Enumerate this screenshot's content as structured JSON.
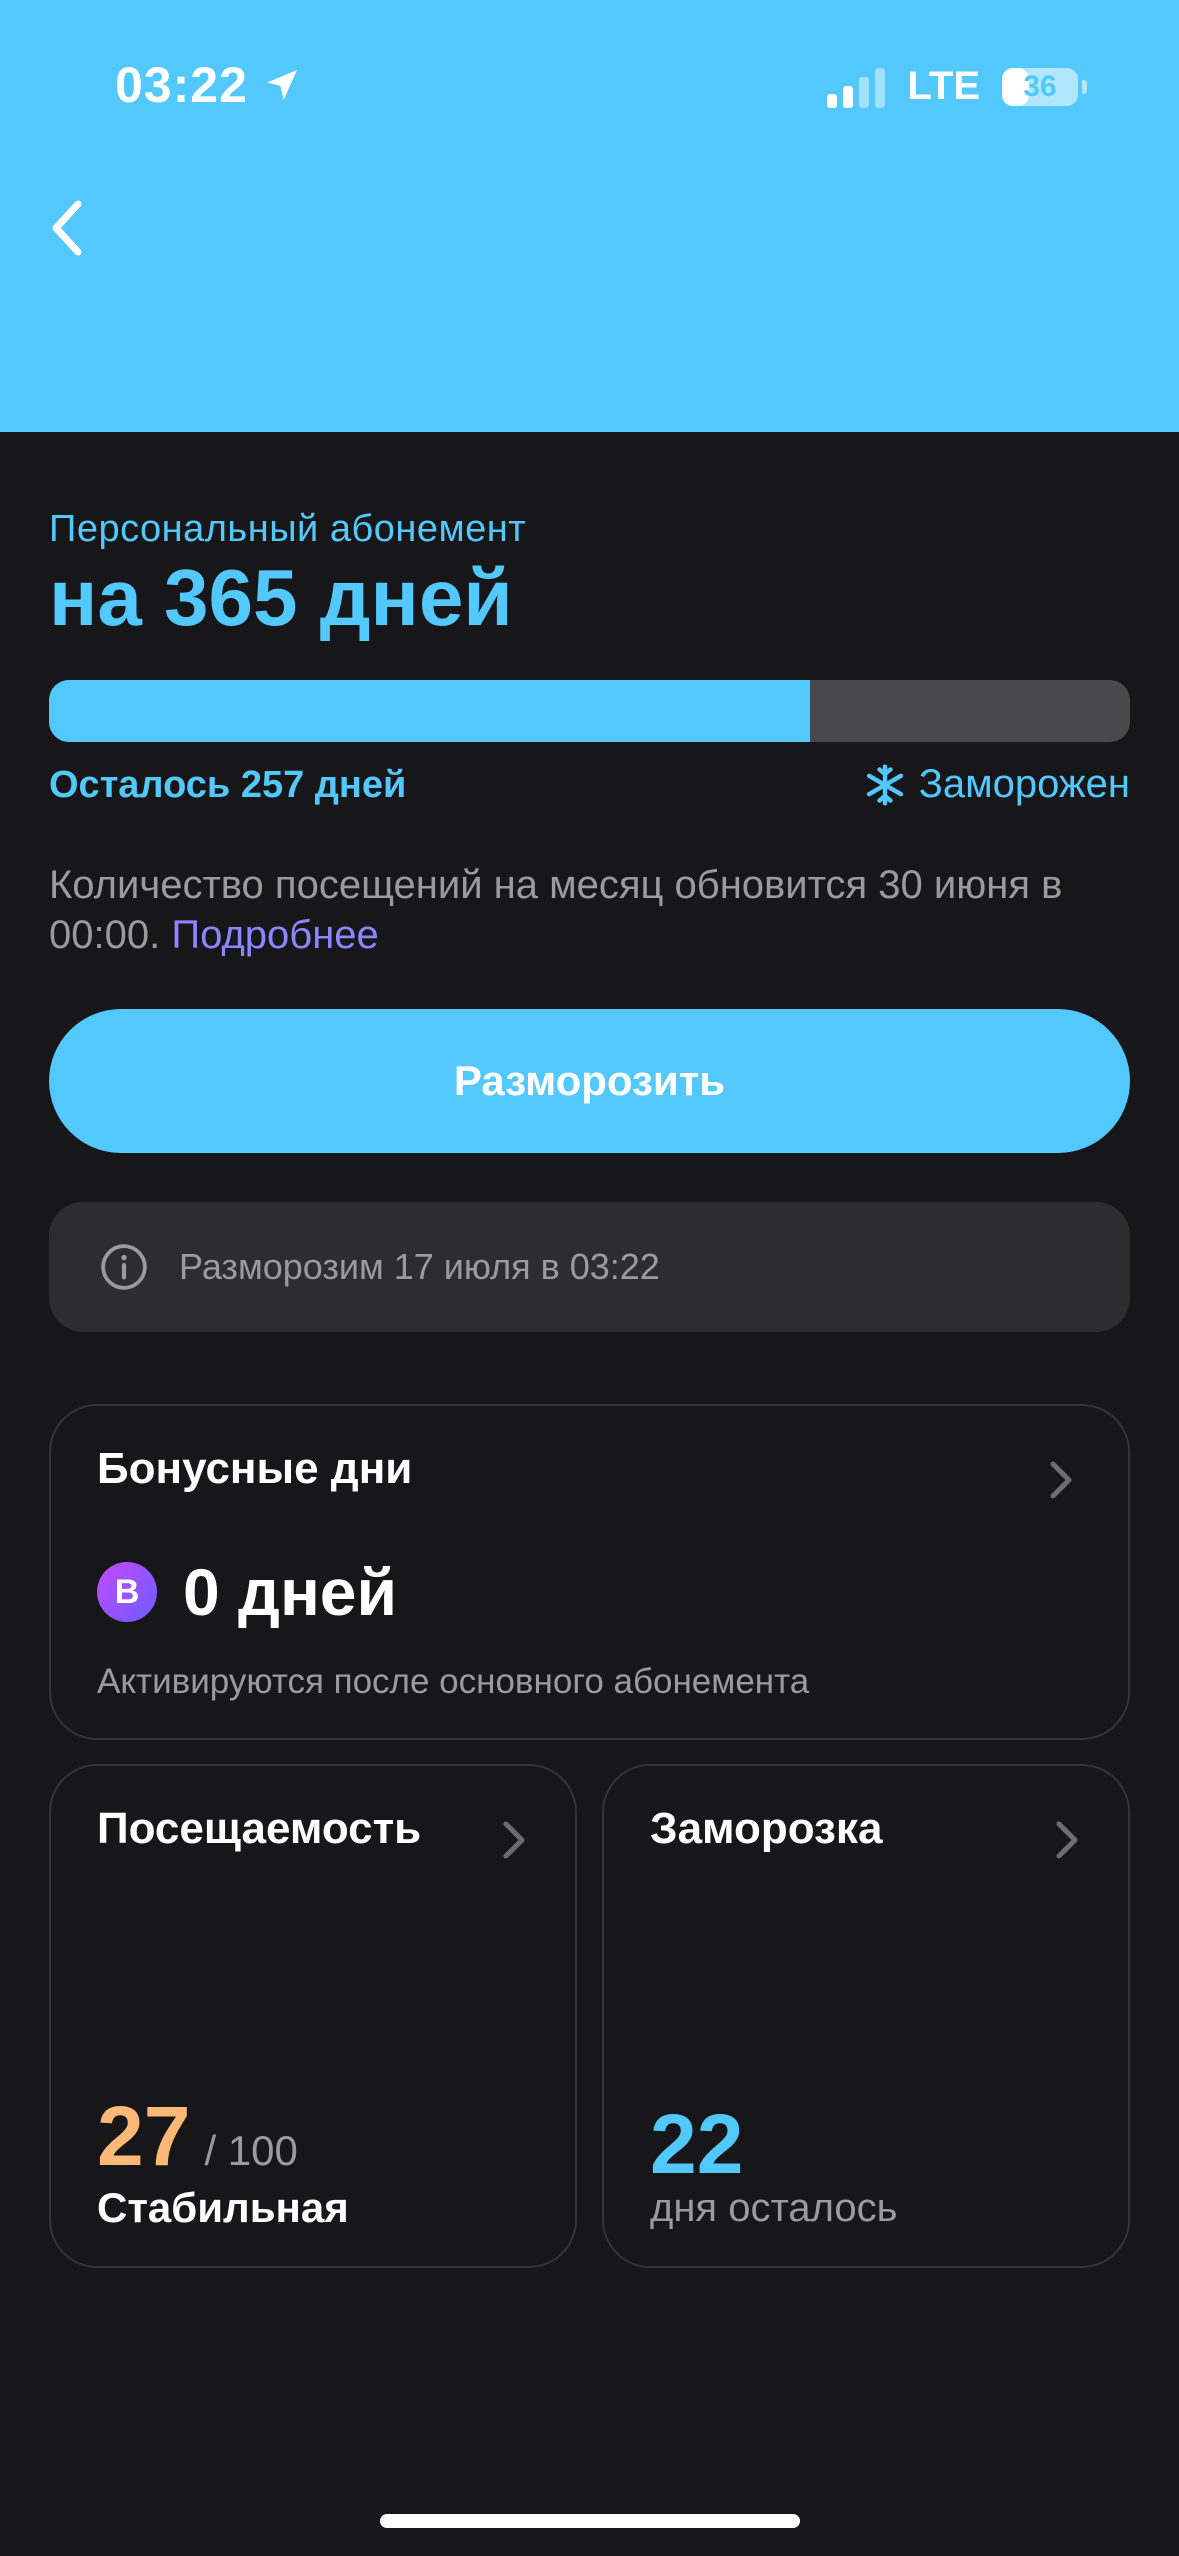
{
  "status_bar": {
    "time": "03:22",
    "network": "LTE",
    "battery": "36",
    "battery_level": 0.36,
    "location_icon": "location-arrow-icon",
    "signal_icon": "signal-bars-icon"
  },
  "header": {
    "back_icon": "chevron-left-icon",
    "color": "#52c8fd"
  },
  "subscription": {
    "subtitle": "Персональный абонемент",
    "title": "на 365 дней",
    "progress_fraction": 0.704,
    "remaining": "Осталось 257 дней",
    "status_icon": "snowflake-icon",
    "status": "Заморожен",
    "info_text": "Количество посещений на месяц обновится 30 июня в 00:00.",
    "info_link": "Подробнее",
    "unfreeze_button": "Разморозить",
    "notice_icon": "info-circle-icon",
    "notice": "Разморозим 17 июля в 03:22"
  },
  "bonus_card": {
    "title": "Бонусные дни",
    "badge": "B",
    "value": "0 дней",
    "description": "Активируются после основного абонемента"
  },
  "attendance_card": {
    "title": "Посещаемость",
    "score": "27",
    "max": "/ 100",
    "label": "Стабильная"
  },
  "freeze_card": {
    "title": "Заморозка",
    "value": "22",
    "label": "дня осталось"
  },
  "colors": {
    "accent": "#52c8fd",
    "background": "#17171a",
    "attendance": "#fbb876",
    "link": "#8c86ff"
  }
}
